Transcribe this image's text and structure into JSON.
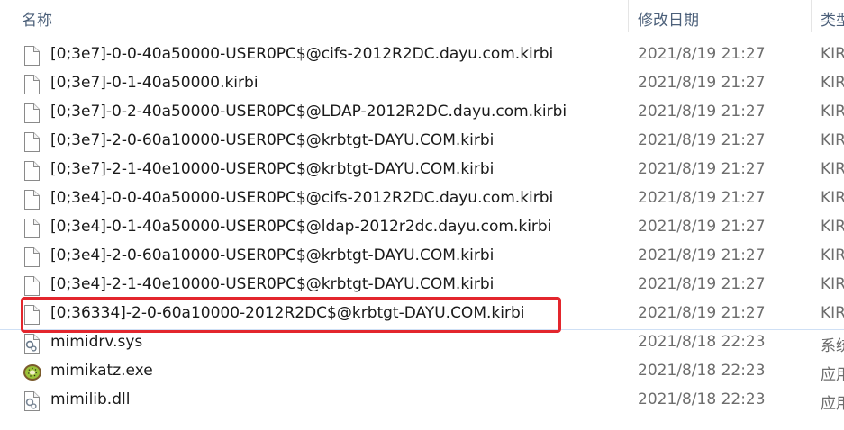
{
  "header": {
    "name_label": "名称",
    "date_label": "修改日期",
    "type_label": "类型"
  },
  "files": [
    {
      "name": "[0;3e7]-0-0-40a50000-USER0PC$@cifs-2012R2DC.dayu.com.kirbi",
      "date": "2021/8/19 21:27",
      "type": "KIRBI",
      "icon": "generic-file-icon"
    },
    {
      "name": "[0;3e7]-0-1-40a50000.kirbi",
      "date": "2021/8/19 21:27",
      "type": "KIRBI",
      "icon": "generic-file-icon"
    },
    {
      "name": "[0;3e7]-0-2-40a50000-USER0PC$@LDAP-2012R2DC.dayu.com.kirbi",
      "date": "2021/8/19 21:27",
      "type": "KIRBI",
      "icon": "generic-file-icon"
    },
    {
      "name": "[0;3e7]-2-0-60a10000-USER0PC$@krbtgt-DAYU.COM.kirbi",
      "date": "2021/8/19 21:27",
      "type": "KIRBI",
      "icon": "generic-file-icon"
    },
    {
      "name": "[0;3e7]-2-1-40e10000-USER0PC$@krbtgt-DAYU.COM.kirbi",
      "date": "2021/8/19 21:27",
      "type": "KIRBI",
      "icon": "generic-file-icon"
    },
    {
      "name": "[0;3e4]-0-0-40a50000-USER0PC$@cifs-2012R2DC.dayu.com.kirbi",
      "date": "2021/8/19 21:27",
      "type": "KIRBI",
      "icon": "generic-file-icon"
    },
    {
      "name": "[0;3e4]-0-1-40a50000-USER0PC$@ldap-2012r2dc.dayu.com.kirbi",
      "date": "2021/8/19 21:27",
      "type": "KIRBI",
      "icon": "generic-file-icon"
    },
    {
      "name": "[0;3e4]-2-0-60a10000-USER0PC$@krbtgt-DAYU.COM.kirbi",
      "date": "2021/8/19 21:27",
      "type": "KIRBI",
      "icon": "generic-file-icon"
    },
    {
      "name": "[0;3e4]-2-1-40e10000-USER0PC$@krbtgt-DAYU.COM.kirbi",
      "date": "2021/8/19 21:27",
      "type": "KIRBI",
      "icon": "generic-file-icon"
    },
    {
      "name": "[0;36334]-2-0-60a10000-2012R2DC$@krbtgt-DAYU.COM.kirbi",
      "date": "2021/8/19 21:27",
      "type": "KIRBI",
      "icon": "generic-file-icon"
    },
    {
      "name": "mimidrv.sys",
      "date": "2021/8/18 22:23",
      "type": "系统文件",
      "icon": "system-file-icon"
    },
    {
      "name": "mimikatz.exe",
      "date": "2021/8/18 22:23",
      "type": "应用程序",
      "icon": "kiwi-app-icon"
    },
    {
      "name": "mimilib.dll",
      "date": "2021/8/18 22:23",
      "type": "应用程序扩展",
      "icon": "dll-file-icon"
    }
  ],
  "highlight": {
    "row": 9,
    "color": "#e3262d"
  }
}
